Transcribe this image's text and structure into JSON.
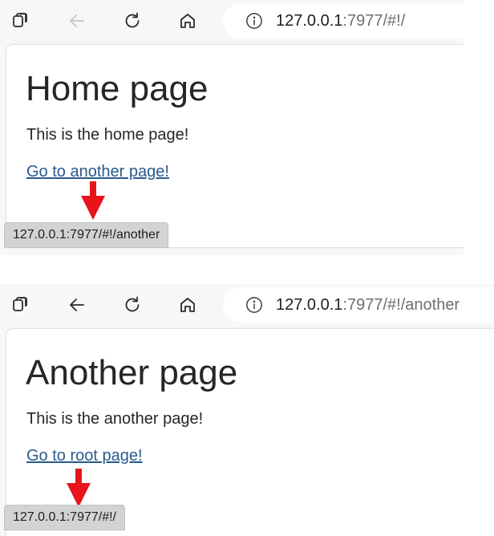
{
  "top": {
    "toolbar": {
      "tabs_icon": "tabs-icon",
      "back_icon": "back-arrow-icon",
      "refresh_icon": "refresh-icon",
      "home_icon": "home-icon",
      "info_icon": "info-icon",
      "back_enabled": false
    },
    "url": {
      "host": "127.0.0.1",
      "path": ":7977/#!/"
    },
    "page": {
      "title": "Home page",
      "description": "This is the home page!",
      "link_text": "Go to another page!"
    },
    "status_url": "127.0.0.1:7977/#!/another"
  },
  "bottom": {
    "toolbar": {
      "tabs_icon": "tabs-icon",
      "back_icon": "back-arrow-icon",
      "refresh_icon": "refresh-icon",
      "home_icon": "home-icon",
      "info_icon": "info-icon",
      "back_enabled": true
    },
    "url": {
      "host": "127.0.0.1",
      "path": ":7977/#!/another"
    },
    "page": {
      "title": "Another page",
      "description": "This is the another page!",
      "link_text": "Go to root page!"
    },
    "status_url": "127.0.0.1:7977/#!/"
  },
  "colors": {
    "arrow": "#e8141c",
    "link": "#2a5a8c",
    "toolbar_bg": "#f7f7f7",
    "status_bg": "#d3d3d3"
  }
}
